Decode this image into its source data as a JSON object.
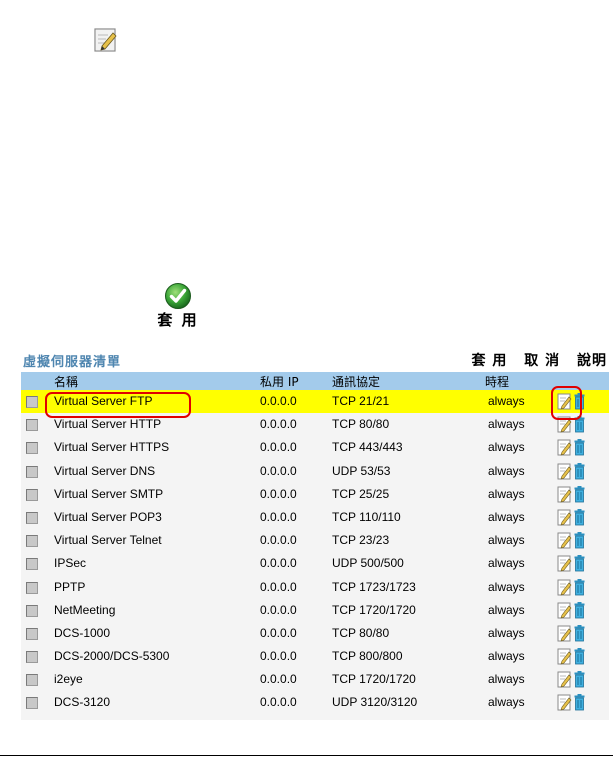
{
  "apply_button": {
    "label": "套 用"
  },
  "list": {
    "title": "虛擬伺服器清單",
    "actions": {
      "apply": "套 用",
      "cancel": "取 消",
      "help": "說明"
    },
    "columns": {
      "name": "名稱",
      "private_ip": "私用 IP",
      "protocol": "通訊協定",
      "schedule": "時程"
    },
    "rows": [
      {
        "name": "Virtual Server FTP",
        "ip": "0.0.0.0",
        "proto": "TCP 21/21",
        "sched": "always",
        "highlight": true
      },
      {
        "name": "Virtual Server HTTP",
        "ip": "0.0.0.0",
        "proto": "TCP 80/80",
        "sched": "always"
      },
      {
        "name": "Virtual Server HTTPS",
        "ip": "0.0.0.0",
        "proto": "TCP 443/443",
        "sched": "always"
      },
      {
        "name": "Virtual Server DNS",
        "ip": "0.0.0.0",
        "proto": "UDP 53/53",
        "sched": "always"
      },
      {
        "name": "Virtual Server SMTP",
        "ip": "0.0.0.0",
        "proto": "TCP 25/25",
        "sched": "always"
      },
      {
        "name": "Virtual Server POP3",
        "ip": "0.0.0.0",
        "proto": "TCP 110/110",
        "sched": "always"
      },
      {
        "name": "Virtual Server Telnet",
        "ip": "0.0.0.0",
        "proto": "TCP 23/23",
        "sched": "always"
      },
      {
        "name": "IPSec",
        "ip": "0.0.0.0",
        "proto": "UDP 500/500",
        "sched": "always"
      },
      {
        "name": "PPTP",
        "ip": "0.0.0.0",
        "proto": "TCP 1723/1723",
        "sched": "always"
      },
      {
        "name": "NetMeeting",
        "ip": "0.0.0.0",
        "proto": "TCP 1720/1720",
        "sched": "always"
      },
      {
        "name": "DCS-1000",
        "ip": "0.0.0.0",
        "proto": "TCP 80/80",
        "sched": "always"
      },
      {
        "name": "DCS-2000/DCS-5300",
        "ip": "0.0.0.0",
        "proto": "TCP 800/800",
        "sched": "always"
      },
      {
        "name": "i2eye",
        "ip": "0.0.0.0",
        "proto": "TCP 1720/1720",
        "sched": "always"
      },
      {
        "name": "DCS-3120",
        "ip": "0.0.0.0",
        "proto": "UDP 3120/3120",
        "sched": "always"
      }
    ]
  },
  "icons": {
    "top": "edit-icon",
    "apply": "check-icon",
    "row_edit": "edit-icon",
    "row_delete": "trash-icon"
  },
  "colors": {
    "highlight": "#ffff00",
    "header_bg": "#a3cbeb",
    "title": "#4f86b0",
    "callout": "#e00000"
  }
}
